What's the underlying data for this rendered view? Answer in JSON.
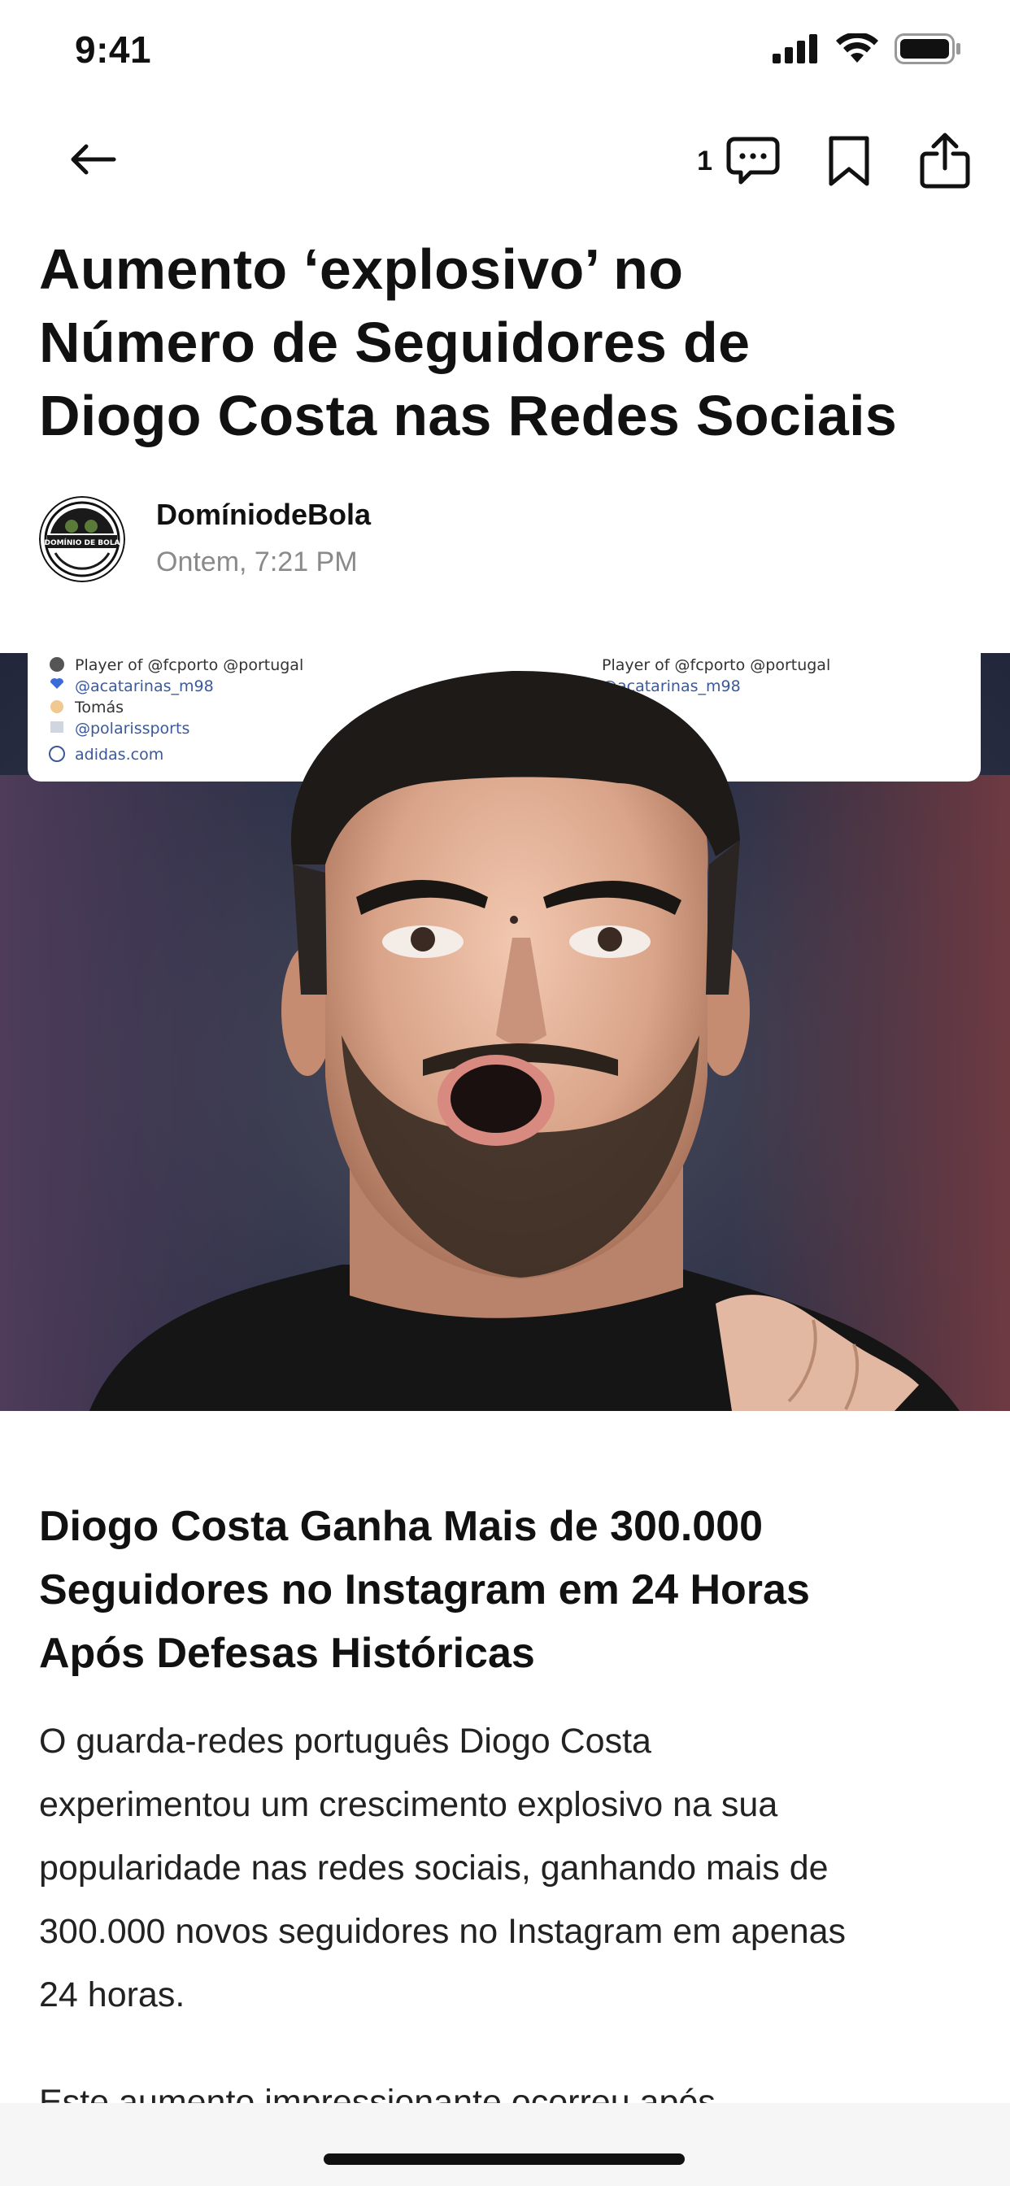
{
  "status_bar": {
    "time": "9:41"
  },
  "nav": {
    "comment_count": "1"
  },
  "article": {
    "title_line1": "Aumento ‘explosivo’ no",
    "title_line2": "Número de Seguidores de",
    "title_line3": "Diogo Costa nas Redes Sociais",
    "author": "DomíniodeBola",
    "timestamp": "Ontem, 7:21 PM",
    "avatar_logo_text": "DOMÍNIO DE BOLA",
    "hero": {
      "bio_lines": [
        "Player of @fcporto @portugal",
        "@acatarinas_m98",
        "Tomás",
        "@polarissports",
        "adidas.com"
      ],
      "bio_lines_right": [
        "Player of @fcporto @portugal",
        "@acatarinas_m98"
      ]
    },
    "subheading_line1": "Diogo Costa Ganha Mais de 300.000",
    "subheading_line2": "Seguidores no Instagram em 24 Horas",
    "subheading_line3": "Após Defesas Históricas",
    "paragraph_line1": "O guarda-redes português Diogo Costa",
    "paragraph_line2": "experimentou um crescimento explosivo na sua",
    "paragraph_line3": "popularidade nas redes sociais, ganhando mais de",
    "paragraph_line4": "300.000 novos seguidores no Instagram em apenas",
    "paragraph_line5": "24 horas.",
    "next_paragraph_peek": "Este aumento impressionante ocorreu após"
  },
  "icons": [
    "signal-icon",
    "wifi-icon",
    "battery-icon",
    "back-arrow-icon",
    "comment-icon",
    "bookmark-icon",
    "share-icon"
  ]
}
